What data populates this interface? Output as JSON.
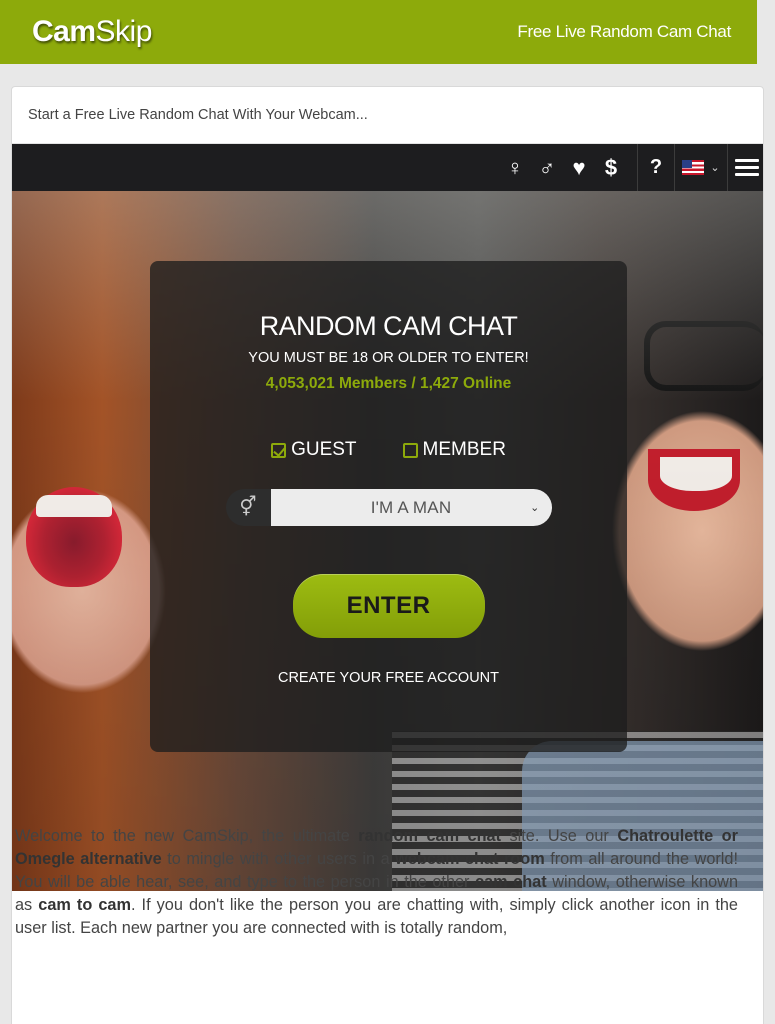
{
  "header": {
    "logo_bold": "Cam",
    "logo_regular": "Skip",
    "tagline": "Free Live Random Cam Chat"
  },
  "intro": "Start a Free Live Random Chat With Your Webcam...",
  "toolbar": {
    "female": "♀",
    "male": "♂",
    "heart": "♥",
    "dollar": "$",
    "help": "?",
    "language": "US",
    "menu": "menu"
  },
  "panel": {
    "title": "RANDOM CAM CHAT",
    "age_notice": "YOU MUST BE 18 OR OLDER TO ENTER!",
    "stats": "4,053,021 Members / 1,427 Online",
    "guest_label": "GUEST",
    "member_label": "MEMBER",
    "gender_selected": "I'M A MAN",
    "enter_label": "ENTER",
    "create_account": "CREATE YOUR FREE ACCOUNT"
  },
  "description": {
    "p1": "Welcome to the new CamSkip, the ultimate ",
    "b1": "random cam chat",
    "p2": " site. Use our ",
    "b2": "Chatroulette or Omegle alternative",
    "p3": " to mingle with other users in a ",
    "b3": "webcam chat room",
    "p4": " from all around the world! You will be able hear, see, and type to the person in the other ",
    "b4": "cam chat",
    "p5": " window, otherwise known as ",
    "b5": "cam to cam",
    "p6": ". If you don't like the person you are chatting with, simply click another icon in the user list. Each new partner you are connected with is totally random,"
  },
  "colors": {
    "brand_green": "#8daa0b",
    "toolbar_bg": "#1d1d1f"
  }
}
